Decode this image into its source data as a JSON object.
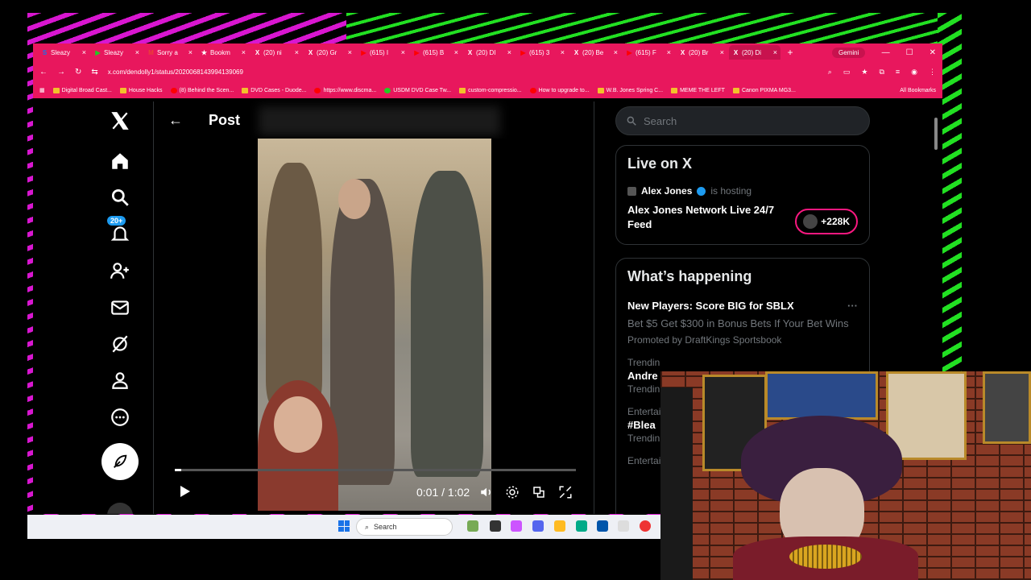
{
  "tabs": [
    {
      "label": "Sleazy",
      "fav": "S",
      "color": "#1a73e8"
    },
    {
      "label": "Sleazy",
      "fav": "▶",
      "color": "#2c2"
    },
    {
      "label": "Sorry a",
      "fav": "M",
      "color": "#ea4335"
    },
    {
      "label": "Bookm",
      "fav": "★",
      "color": "#fff"
    },
    {
      "label": "(20) ni",
      "fav": "X",
      "color": "#fff"
    },
    {
      "label": "(20) Gr",
      "fav": "X",
      "color": "#fff"
    },
    {
      "label": "(615) I",
      "fav": "▶",
      "color": "#f00"
    },
    {
      "label": "(615) B",
      "fav": "▶",
      "color": "#f00"
    },
    {
      "label": "(20) DI",
      "fav": "X",
      "color": "#fff"
    },
    {
      "label": "(615) 3",
      "fav": "▶",
      "color": "#f00"
    },
    {
      "label": "(20) Be",
      "fav": "X",
      "color": "#fff"
    },
    {
      "label": "(615) F",
      "fav": "▶",
      "color": "#f00"
    },
    {
      "label": "(20) Br",
      "fav": "X",
      "color": "#fff"
    },
    {
      "label": "(20) Di",
      "fav": "X",
      "color": "#fff"
    }
  ],
  "gemini_label": "Gemini",
  "url": "x.com/dendolly1/status/2020068143994139069",
  "bookmarks": [
    "Digital Broad Cast...",
    "House Hacks",
    "(8) Behind the Scen...",
    "DVD Cases - Duode...",
    "https://www.discma...",
    "USDM DVD Case Tw...",
    "custom-compressio...",
    "How to upgrade to...",
    "W.B. Jones Spring C...",
    "MEME THE LEFT",
    "Canon PIXMA MG3..."
  ],
  "all_bookmarks": "All Bookmarks",
  "nav": {
    "badge": "20+"
  },
  "post": {
    "title": "Post"
  },
  "video": {
    "time": "0:01 / 1:02",
    "progress": 0.016
  },
  "search": {
    "placeholder": "Search"
  },
  "live": {
    "heading": "Live on X",
    "host_name": "Alex Jones",
    "hosting": "is hosting",
    "title": "Alex Jones Network Live 24/7 Feed",
    "listeners": "+228K"
  },
  "happening": {
    "heading": "What’s happening",
    "promo_title": "New Players: Score BIG for SBLX",
    "promo_desc": "Bet $5 Get $300 in Bonus Bets If Your Bet Wins",
    "promo_by": "Promoted by DraftKings Sportsbook",
    "trend1_cat": "Trendin",
    "trend1_title": "Andre",
    "trend1_sub": "Trendin",
    "trend2_cat": "Entertai",
    "trend2_title": "#Blea",
    "trend2_sub": "Trendin",
    "trend3_cat": "Entertai"
  },
  "taskbar": {
    "search": "Search"
  }
}
